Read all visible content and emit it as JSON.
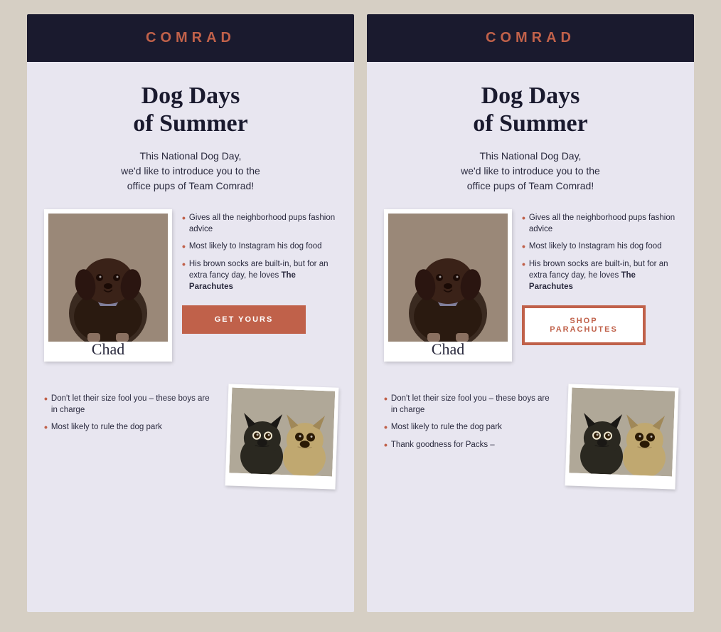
{
  "panels": [
    {
      "id": "panel-left",
      "brand": "COMRAD",
      "headline": "Dog Days\nof Summer",
      "subheadline": "This National Dog Day,\nwe'd like to introduce you to the\noffice pups of Team Comrad!",
      "dog_section": {
        "dog_name": "Chad",
        "bullets": [
          "Gives all the neighborhood pups fashion advice",
          "Most likely to Instagram his dog food",
          "His brown socks are built-in, but for an extra fancy day, he loves The Parachutes"
        ],
        "cta_label": "GET YOURS",
        "cta_type": "filled"
      },
      "bottom_bullets": [
        "Don't let their size fool you – these boys are in charge",
        "Most likely to rule the dog park"
      ]
    },
    {
      "id": "panel-right",
      "brand": "COMRAD",
      "headline": "Dog Days\nof Summer",
      "subheadline": "This National Dog Day,\nwe'd like to introduce you to the\noffice pups of Team Comrad!",
      "dog_section": {
        "dog_name": "Chad",
        "bullets": [
          "Gives all the neighborhood pups fashion advice",
          "Most likely to Instagram his dog food",
          "His brown socks are built-in, but for an extra fancy day, he loves The Parachutes"
        ],
        "cta_label": "SHOP PARACHUTES",
        "cta_type": "outlined"
      },
      "bottom_bullets": [
        "Don't let their size fool you – these boys are in charge",
        "Most likely to rule the dog park",
        "Thank goodness for Packs –"
      ]
    }
  ],
  "accent_color": "#c0614a",
  "dark_color": "#1a1a2e",
  "bg_color": "#d6cfc4",
  "panel_bg": "#e8e6f0"
}
